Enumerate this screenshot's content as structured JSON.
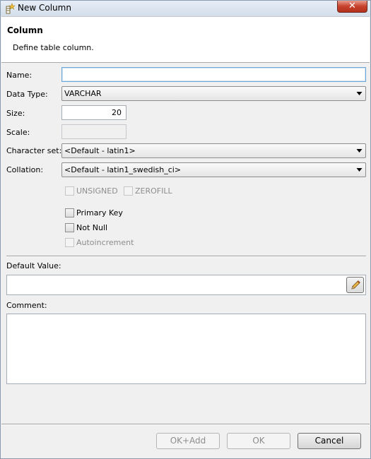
{
  "window": {
    "title": "New Column",
    "close_glyph": "✕"
  },
  "header": {
    "title": "Column",
    "description": "Define table column."
  },
  "fields": {
    "name_label": "Name:",
    "name_value": "",
    "data_type_label": "Data Type:",
    "data_type_value": "VARCHAR",
    "size_label": "Size:",
    "size_value": "20",
    "scale_label": "Scale:",
    "scale_value": "",
    "charset_label": "Character set:",
    "charset_value": "<Default - latin1>",
    "collation_label": "Collation:",
    "collation_value": "<Default - latin1_swedish_ci>"
  },
  "checkboxes": {
    "unsigned": "UNSIGNED",
    "zerofill": "ZEROFILL",
    "primary_key": "Primary Key",
    "not_null": "Not Null",
    "autoincrement": "Autoincrement"
  },
  "default_value": {
    "label": "Default Value:",
    "value": ""
  },
  "comment": {
    "label": "Comment:",
    "value": ""
  },
  "buttons": {
    "ok_add": "OK+Add",
    "ok": "OK",
    "cancel": "Cancel"
  },
  "icons": {
    "title": "column-star-icon",
    "edit": "pencil-icon",
    "dropdown": "chevron-down-icon"
  }
}
